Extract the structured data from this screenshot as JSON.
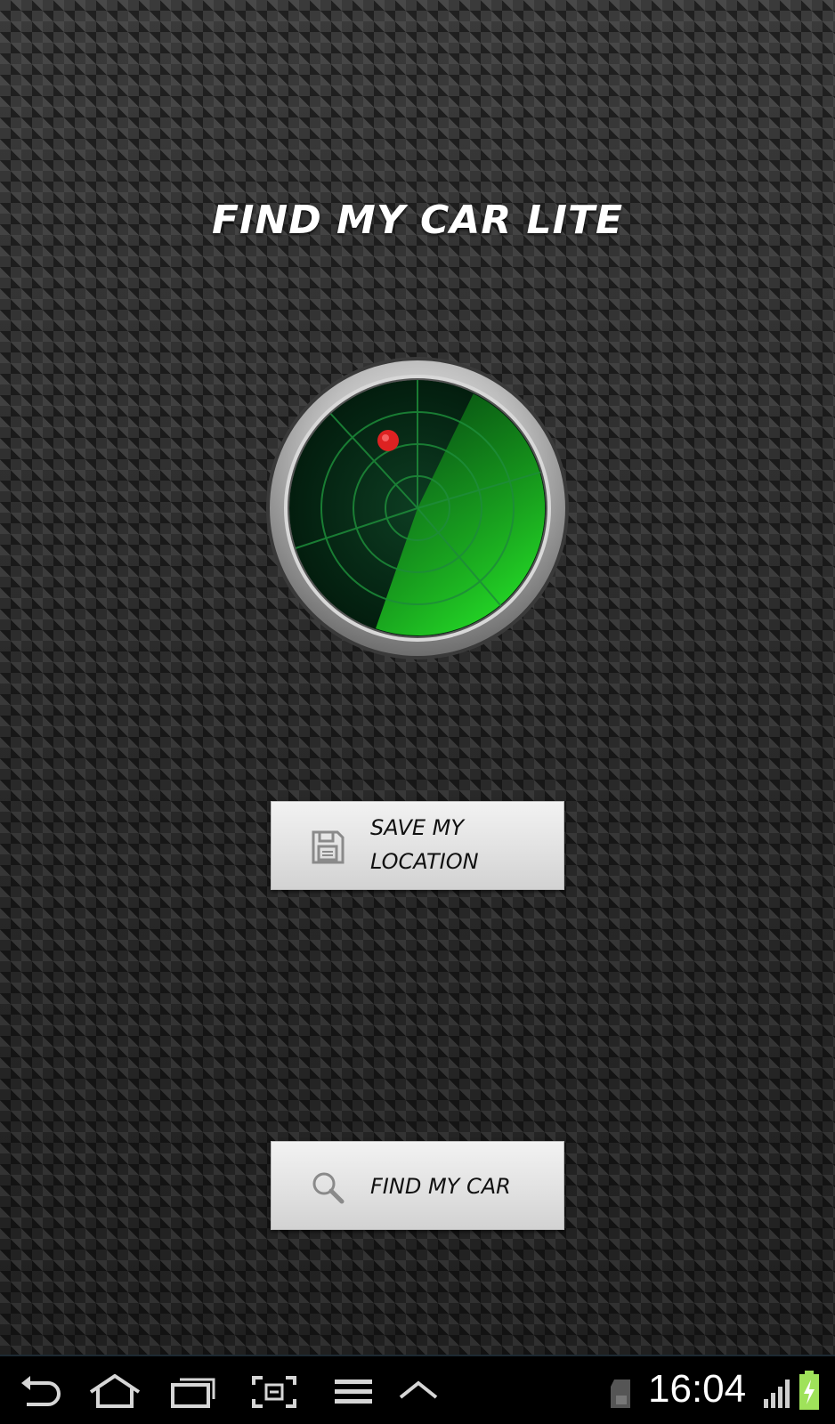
{
  "app": {
    "title": "FIND MY CAR LITE",
    "accent_color": "#22dd22",
    "target_dot_color": "#dd2222"
  },
  "buttons": {
    "save": {
      "line1": "SAVE MY",
      "line2": "LOCATION",
      "icon": "floppy-disk-icon"
    },
    "find": {
      "label": "FIND MY CAR",
      "icon": "magnifier-icon"
    }
  },
  "navbar": {
    "items": [
      {
        "name": "back",
        "icon": "back-arrow-icon"
      },
      {
        "name": "home",
        "icon": "home-icon"
      },
      {
        "name": "recent-apps",
        "icon": "recent-apps-icon"
      },
      {
        "name": "screenshot",
        "icon": "screenshot-icon"
      },
      {
        "name": "menu",
        "icon": "menu-icon"
      },
      {
        "name": "expand",
        "icon": "chevron-up-icon"
      }
    ],
    "status": {
      "time": "16:04",
      "sd_card_icon": "sd-card-icon",
      "signal_icon": "signal-bars-icon",
      "battery_icon": "battery-charging-icon"
    }
  }
}
